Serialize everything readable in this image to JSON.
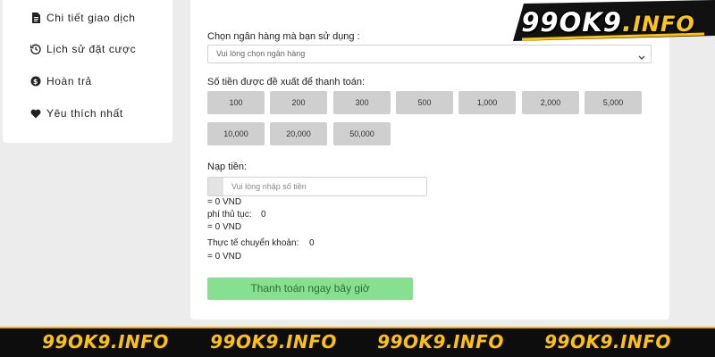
{
  "sidebar": {
    "items": [
      {
        "label": "Chi tiết giao dịch",
        "icon": "document-icon"
      },
      {
        "label": "Lịch sử đặt cược",
        "icon": "history-icon"
      },
      {
        "label": "Hoàn trả",
        "icon": "coin-icon"
      },
      {
        "label": "Yêu thích nhất",
        "icon": "heart-icon"
      }
    ]
  },
  "form": {
    "bank_label": "Chọn ngân hàng mà bạn sử dụng :",
    "bank_placeholder": "Vui lòng chọn ngân hàng",
    "suggested_label": "Số tiền được đề xuất để thanh toán:",
    "amounts": [
      "100",
      "200",
      "300",
      "500",
      "1,000",
      "2,000",
      "5,000",
      "10,000",
      "20,000",
      "50,000"
    ],
    "deposit_label": "Nạp tiền:",
    "deposit_placeholder": "Vui lòng nhập số tiền",
    "deposit_equiv": "= 0 VND",
    "fee_label": "phí thủ tục:",
    "fee_value": "0",
    "fee_equiv": "= 0 VND",
    "actual_label": "Thực tế chuyển khoản:",
    "actual_value": "0",
    "actual_equiv": "= 0 VND",
    "pay_button": "Thanh toán ngay bây giờ"
  },
  "branding": {
    "logo_main": "99OK9",
    "logo_dot": ".",
    "logo_suffix": "INFO",
    "watermark": "99OK9.INFO",
    "accent_color": "#ffc400",
    "pay_button_color": "#86e08f"
  }
}
